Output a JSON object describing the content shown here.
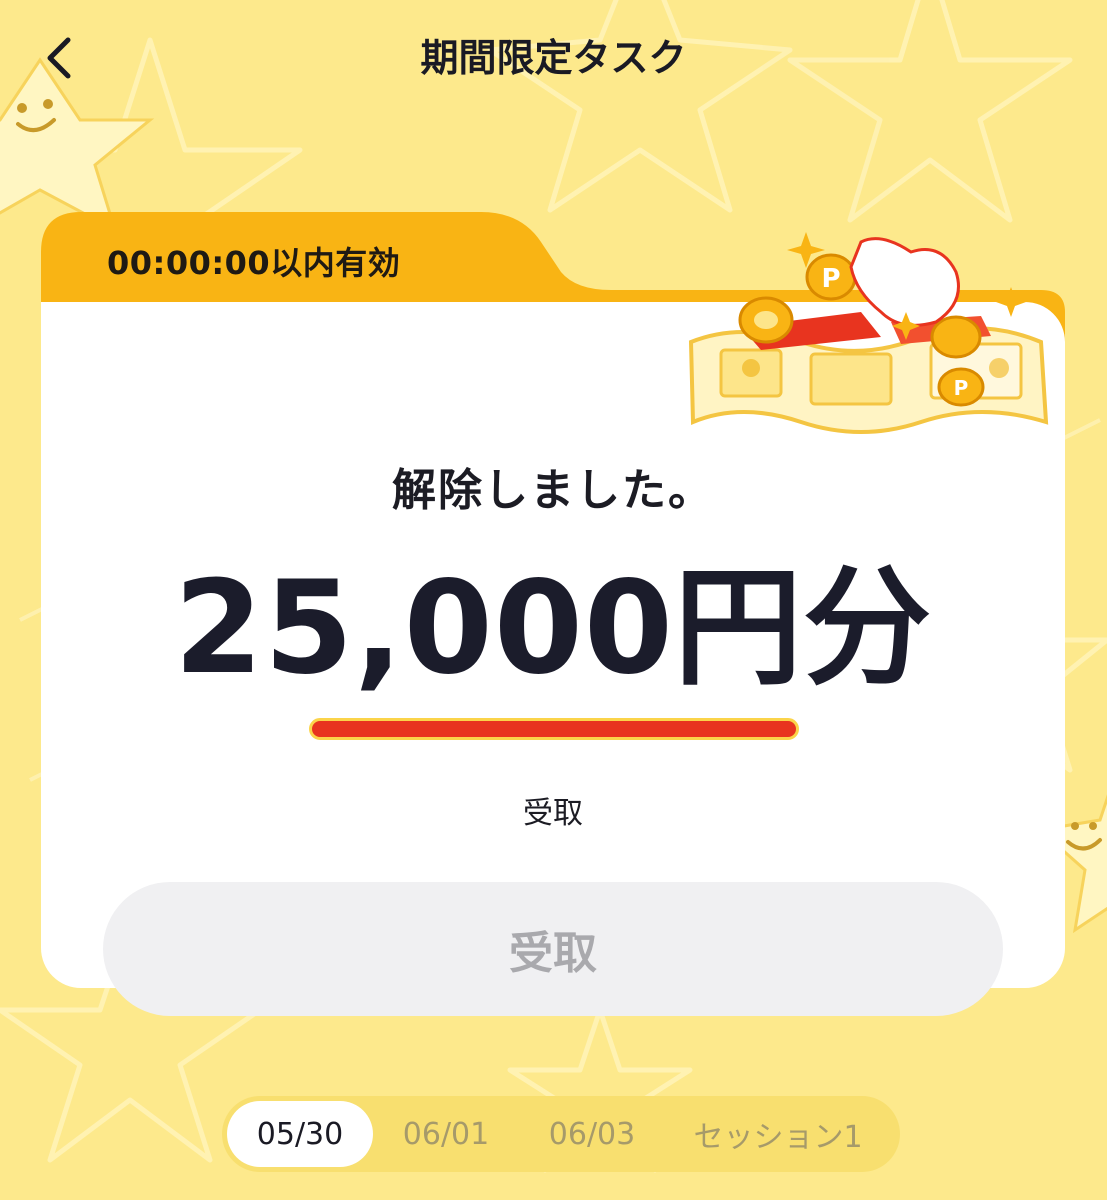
{
  "header": {
    "title": "期間限定タスク"
  },
  "task_card": {
    "timer": "00:00:00以内有効",
    "status": "解除しました。",
    "amount": "25,000円分",
    "receive_label": "受取",
    "receive_button_label": "受取"
  },
  "date_tabs": [
    {
      "label": "05/30",
      "active": true
    },
    {
      "label": "06/01",
      "active": false
    },
    {
      "label": "06/03",
      "active": false
    },
    {
      "label": "セッション1",
      "active": false
    }
  ],
  "colors": {
    "background": "#fde98c",
    "tab_accent": "#f9b414",
    "progress_red": "#e8341f",
    "button_disabled_bg": "#f0f0f2",
    "button_disabled_text": "#a9a9ad"
  }
}
